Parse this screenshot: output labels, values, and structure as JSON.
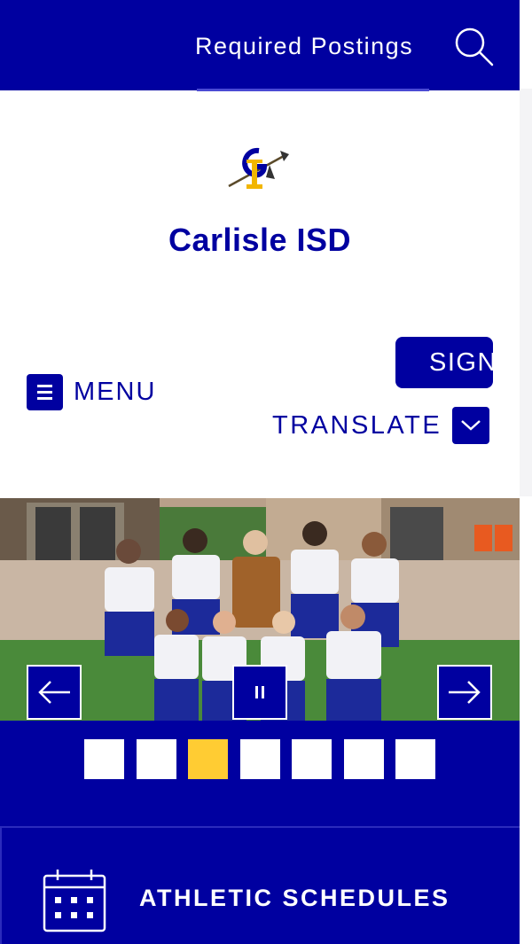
{
  "header": {
    "required_postings": "Required Postings",
    "search_icon": "search-icon"
  },
  "site": {
    "logo_alt": "CI",
    "title": "Carlisle ISD"
  },
  "nav": {
    "menu_label": "MENU",
    "sign_in_label": "SIGN",
    "translate_label": "TRANSLATE"
  },
  "slideshow": {
    "prev_icon": "arrow-left-icon",
    "next_icon": "arrow-right-icon",
    "pause_icon": "pause-icon",
    "slide_count": 7,
    "active_index": 2
  },
  "quick_links": [
    {
      "label": "ATHLETIC SCHEDULES",
      "icon": "calendar-icon"
    }
  ],
  "colors": {
    "primary": "#0000a0",
    "accent": "#ffcc33",
    "white": "#ffffff"
  }
}
